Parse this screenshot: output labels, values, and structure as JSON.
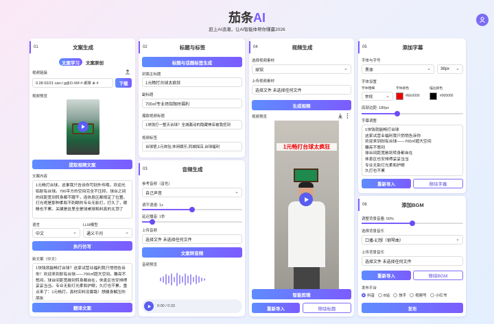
{
  "header": {
    "title": "茄条",
    "title_ai": "AI",
    "subtitle": "赶上AI浪潮，让AI智能体帮你赚赢2026"
  },
  "colors": {
    "accent": "#7b5cff",
    "accent2": "#5f8cff"
  },
  "p1": {
    "num": "01",
    "title": "文案生成",
    "tab1": "文案学习",
    "tab2": "文案原创",
    "link_label": "视频链接",
    "link_value": "0.28 02/21 can:/ g@O.XM # 桌球 ⊕ #",
    "download_btn": "下载",
    "preview_label": "视频预览",
    "get_btn": "提取视频文案",
    "content_label": "文案内容",
    "content_text": "1元畅打台球，这事我只告诉你可别外传哦，欢迎光临耐有台球。700平方的空间完全不压抑，球台之间的间距宽到转身都不蹭干，连休息区都规定了位置。灯光呢是那种柔和不刺眼的专业无影灯，打久了，眼睛也不累。关键是这里全是球桌球耗料真的太顶了",
    "lang_label": "语言",
    "lang_value": "中文",
    "model_label": "LLM模型",
    "model_value": "通义千问",
    "rewrite_btn": "执行仿写",
    "result_label": "新文案（中文）",
    "result_text": "1块钱就能畅打台球？这家试营业福利我只悄悄告诉你！欢迎来到耐有台球——700㎡超大空间，雕亮不憋闷，球台间距宽敞到转身都自在，休息区也安排得妥妥当当。专业无影灯光柔和护眼，久打也不累。重点来了：1元畅打，真材实料没套路！想健身解压的朋友",
    "translate_btn": "翻译文案"
  },
  "p2": {
    "num": "02",
    "title": "标题与标签",
    "gen_btn": "标题与话题标签生成",
    "cover_label": "封面主标题",
    "cover_value": "1元畅打台球太疯狂",
    "sub_label": "副标题",
    "sub_value": "700㎡专业场馆限时福利",
    "hot_label": "爆款视频标题",
    "hot_value": "1块钱打一整天台球？全城轰动的隐藏神店被我挖到",
    "tag_label": "视频标签",
    "tag_value": "台球馆,1元体验,休闲娱乐,同城探店,台球福利"
  },
  "p3": {
    "num": "03",
    "title": "音频生成",
    "voice_label": "参考音频（音色）",
    "voice_value": "自己声音",
    "speed_label": "调节语速: 1x",
    "speed": 0.5,
    "delay_label": "延迟播音: 1秒",
    "delay": 0.1,
    "upload_label": "上传音频",
    "upload_value": "选择文件  未选择任何文件",
    "convert_btn": "文案转音频",
    "preview_label": "音频预览",
    "time": "0:00 / 0:33"
  },
  "p4": {
    "num": "04",
    "title": "视频生成",
    "material_label": "选择视频素材",
    "material_value": "球馆",
    "upload_label": "上传视频素材",
    "upload_value": "选择文件  未选择任何文件",
    "gen_btn": "生成视频",
    "preview_label": "视频预览",
    "overlay_text": "1元畅打台球太疯狂",
    "clip_btn": "智能剪辑",
    "reimport_btn": "重新导入",
    "remove_title_btn": "移除标题"
  },
  "p5": {
    "num": "05",
    "title": "添加字幕",
    "font_label": "字体与字号",
    "font_value": "黑体",
    "size_value": "36px",
    "settings_label": "字体设置",
    "weight_label": "字体粗细",
    "weight_value": "常规",
    "color_label": "字体颜色",
    "color_value": "#EE0000",
    "color_hex": "#ee0000",
    "stroke_label": "描边颜色",
    "stroke_value": "#000000",
    "stroke_hex": "#000000",
    "margin_label": "底部边距: 180px",
    "margin": 0.35,
    "sub_label": "字幕调整",
    "sub_text": "1块钱就能畅打台球\n这家试营业福利我只悄悄告诉你\n欢迎来到耐有台球——700㎡超大空间\n雕亮不憋闷\n球台间距宽敞到转身都自在\n休息区也安排得妥妥当当\n专业无影灯光柔和护眼\n久打也不累",
    "reimport_btn": "重新导入",
    "remove_btn": "移除字幕"
  },
  "p6": {
    "num": "06",
    "title": "添加BGM",
    "vol_label": "调整背景音量: 50%",
    "vol": 0.5,
    "bgm_label": "选择背景音乐",
    "bgm_value": "口播-幻想（钢琴曲）",
    "upload_label": "上传背景音乐",
    "upload_value": "选择文件  未选择任何文件",
    "reimport_btn": "重新导入",
    "remove_btn": "移除BGM",
    "platform_label": "发布平台",
    "platforms": [
      "抖音",
      "B站",
      "快手",
      "视频号",
      "小红书"
    ],
    "publish_btn": "发布"
  }
}
